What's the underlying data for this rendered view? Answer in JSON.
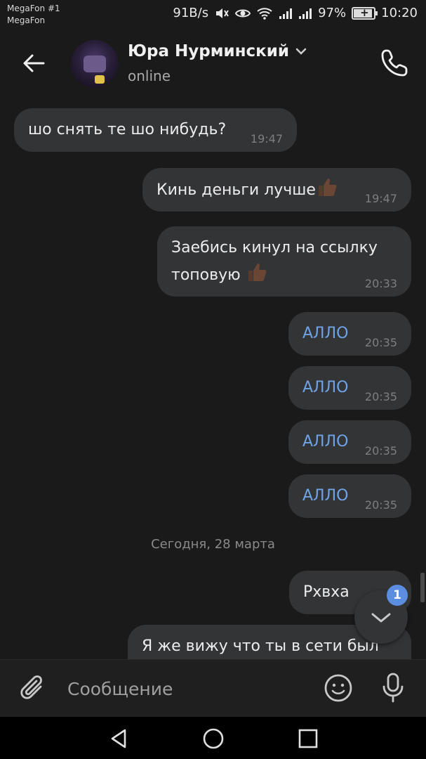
{
  "status_bar": {
    "carrier_1": "MegaFon #1",
    "carrier_2": "MegaFon",
    "net_speed": "91B/s",
    "battery": "97%",
    "time": "10:20"
  },
  "header": {
    "contact_name": "Юра Нурминский",
    "contact_status": "online"
  },
  "messages": [
    {
      "text": "шо снять те шо нибудь?",
      "time": "19:47",
      "direction": "in"
    },
    {
      "text": "Кинь деньги лучше",
      "time": "19:47",
      "direction": "out",
      "emoji": "thumbs-up"
    },
    {
      "text": "Заебись кинул на ссылку",
      "text_2": "топовую",
      "time": "20:33",
      "direction": "out",
      "emoji": "thumbs-up"
    },
    {
      "text": "АЛЛО",
      "time": "20:35",
      "direction": "out"
    },
    {
      "text": "АЛЛО",
      "time": "20:35",
      "direction": "out"
    },
    {
      "text": "АЛЛО",
      "time": "20:35",
      "direction": "out"
    },
    {
      "text": "АЛЛО",
      "time": "20:35",
      "direction": "out"
    },
    {
      "text": "Рхвха",
      "direction": "out"
    },
    {
      "text": "Я же вижу что ты в сети был",
      "direction": "out"
    }
  ],
  "date_separator": "Сегодня, 28 марта",
  "scroll_down": {
    "unread_count": "1"
  },
  "composer": {
    "placeholder": "Сообщение"
  },
  "colors": {
    "background": "#1a1a1a",
    "bubble": "#333436",
    "link_text": "#6fa3e6",
    "badge": "#5b8ee0"
  },
  "icons": [
    "back-arrow-icon",
    "chevron-down-icon",
    "phone-icon",
    "thumbs-up-icon",
    "chevron-down-icon",
    "paperclip-icon",
    "smiley-icon",
    "microphone-icon",
    "nav-back-icon",
    "nav-home-icon",
    "nav-recents-icon"
  ]
}
